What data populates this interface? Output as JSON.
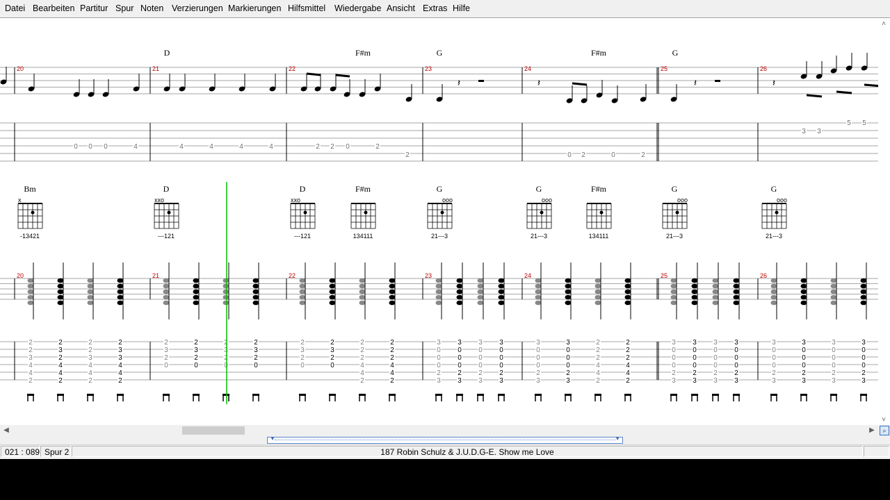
{
  "menu": [
    "Datei",
    "Bearbeiten",
    "Partitur",
    "Spur",
    "Noten",
    "Verzierungen",
    "Markierungen",
    "Hilfsmittel",
    "Wiedergabe",
    "Ansicht",
    "Extras",
    "Hilfe"
  ],
  "system1": {
    "bar_numbers": [
      "20",
      "21",
      "22",
      "23",
      "24",
      "25",
      "26"
    ],
    "chords": [
      "D",
      "F#m",
      "G",
      "F#m",
      "G"
    ],
    "tab_numbers": [
      "0",
      "0",
      "0",
      "4",
      "4",
      "4",
      "4",
      "4",
      "2",
      "2",
      "0",
      "2",
      "2",
      "0",
      "2",
      "0",
      "2",
      "3",
      "3",
      "5",
      "5",
      "5"
    ]
  },
  "system2": {
    "bar_numbers": [
      "20",
      "21",
      "22",
      "23",
      "24",
      "25",
      "26"
    ],
    "chords": [
      {
        "name": "Bm",
        "fingering": "-13421",
        "marks": "x"
      },
      {
        "name": "D",
        "fingering": "---121",
        "marks": "xxo"
      },
      {
        "name": "D",
        "fingering": "---121",
        "marks": "xxo"
      },
      {
        "name": "F#m",
        "fingering": "134111",
        "marks": ""
      },
      {
        "name": "G",
        "fingering": "21---3",
        "marks": "ooo"
      },
      {
        "name": "G",
        "fingering": "21---3",
        "marks": "ooo"
      },
      {
        "name": "F#m",
        "fingering": "134111",
        "marks": ""
      },
      {
        "name": "G",
        "fingering": "21---3",
        "marks": "ooo"
      },
      {
        "name": "G",
        "fingering": "21---3",
        "marks": "ooo"
      }
    ],
    "tab_columns": [
      [
        "2",
        "2",
        "3",
        "4",
        "4",
        "2"
      ],
      [
        "2",
        "3",
        "2",
        "4",
        "4",
        "2"
      ],
      [
        "2",
        "2",
        "3",
        "4",
        "4",
        "2"
      ],
      [
        "2",
        "3",
        "3",
        "4",
        "4",
        "2"
      ],
      [
        "2",
        "3",
        "2",
        "0",
        "",
        ""
      ],
      [
        "2",
        "3",
        "2",
        "0",
        "",
        ""
      ],
      [
        "2",
        "3",
        "2",
        "0",
        "",
        ""
      ],
      [
        "2",
        "3",
        "2",
        "0",
        "",
        ""
      ],
      [
        "2",
        "3",
        "2",
        "0",
        "",
        ""
      ],
      [
        "2",
        "3",
        "2",
        "0",
        "",
        ""
      ],
      [
        "2",
        "2",
        "2",
        "4",
        "4",
        "2"
      ],
      [
        "2",
        "2",
        "2",
        "4",
        "4",
        "2"
      ],
      [
        "3",
        "0",
        "0",
        "0",
        "2",
        "3"
      ],
      [
        "3",
        "0",
        "0",
        "0",
        "2",
        "3"
      ],
      [
        "3",
        "0",
        "0",
        "0",
        "2",
        "3"
      ],
      [
        "3",
        "0",
        "0",
        "0",
        "2",
        "3"
      ],
      [
        "3",
        "0",
        "0",
        "0",
        "2",
        "3"
      ],
      [
        "3",
        "0",
        "0",
        "0",
        "2",
        "3"
      ],
      [
        "2",
        "2",
        "2",
        "4",
        "4",
        "2"
      ],
      [
        "2",
        "2",
        "2",
        "4",
        "4",
        "2"
      ],
      [
        "3",
        "0",
        "0",
        "0",
        "2",
        "3"
      ],
      [
        "3",
        "0",
        "0",
        "0",
        "2",
        "3"
      ],
      [
        "3",
        "0",
        "0",
        "0",
        "2",
        "3"
      ],
      [
        "3",
        "0",
        "0",
        "0",
        "2",
        "3"
      ],
      [
        "3",
        "0",
        "0",
        "0",
        "2",
        "3"
      ],
      [
        "3",
        "0",
        "0",
        "0",
        "2",
        "3"
      ],
      [
        "3",
        "0",
        "0",
        "0",
        "2",
        "3"
      ],
      [
        "3",
        "0",
        "0",
        "0",
        "2",
        "3"
      ]
    ]
  },
  "status": {
    "position": "021 : 089",
    "track": "Spur 2",
    "song": "187  Robin Schulz  & J.U.D.G-E.   Show me Love"
  },
  "colors": {
    "bar_number": "#c00000",
    "cursor": "#00c000",
    "staff": "#000000"
  }
}
